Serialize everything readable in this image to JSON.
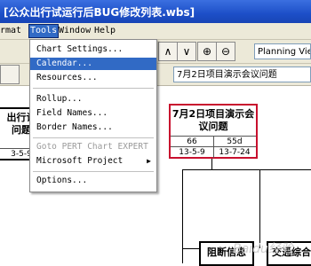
{
  "window": {
    "title": "[公众出行试运行后BUG修改列表.wbs]"
  },
  "menubar": [
    {
      "label": "rmat"
    },
    {
      "label": "Tools"
    },
    {
      "label": "Window"
    },
    {
      "label": "Help"
    }
  ],
  "toolbar": {
    "buttons": [
      "∧",
      "∨",
      "⊕",
      "⊖"
    ],
    "view_combo": "Planning Vie",
    "task_combo": "7月2日项目演示会议问题"
  },
  "tools_menu": [
    {
      "label": "Chart Settings...",
      "state": "normal"
    },
    {
      "label": "Calendar...",
      "state": "highlighted"
    },
    {
      "label": "Resources...",
      "state": "normal"
    },
    {
      "label": "Rollup...",
      "state": "normal"
    },
    {
      "label": "Field Names...",
      "state": "normal"
    },
    {
      "label": "Border Names...",
      "state": "normal"
    },
    {
      "label": "Goto PERT Chart EXPERT",
      "state": "disabled"
    },
    {
      "label": "Microsoft Project",
      "state": "submenu"
    },
    {
      "label": "Options...",
      "state": "normal"
    }
  ],
  "chart": {
    "left_node": {
      "title_1": "出行记",
      "title_2": "问题",
      "date": "3-5-9"
    },
    "selected_node": {
      "title_1": "7月2日项目演示会",
      "title_2": "议问题",
      "id": "66",
      "duration": "55d",
      "start": "13-5-9",
      "finish": "13-7-24"
    },
    "child_nodes": [
      {
        "title": "阻断信息"
      },
      {
        "title": "交通综合"
      }
    ]
  },
  "watermark": "Baidu经验"
}
